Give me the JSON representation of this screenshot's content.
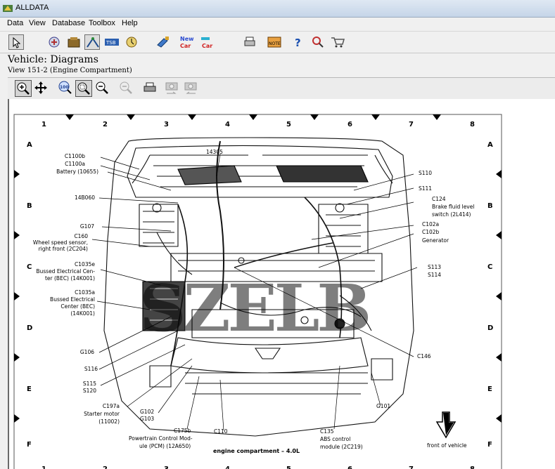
{
  "app": {
    "title": "ALLDATA"
  },
  "menu": [
    "Data",
    "View",
    "Database",
    "Toolbox",
    "Help"
  ],
  "toolbar_icons": [
    "back-icon",
    "repair-icon",
    "vehicle-box-icon",
    "diagram-icon",
    "tsb-icon",
    "labor-icon",
    "components-icon",
    "new-car-icon",
    "new-car-alt-icon",
    "print-icon",
    "note-icon",
    "help-icon",
    "search-icon",
    "cart-icon"
  ],
  "page": {
    "heading": "Vehicle:  Diagrams",
    "subheading": "View 151-2 (Engine Compartment)"
  },
  "diagram_tools": [
    "zoom-in-icon",
    "pan-icon",
    "fit-100-icon",
    "zoom-window-icon",
    "zoom-out-icon",
    "zoom-out-disabled-icon",
    "print-icon",
    "camera-prev-icon",
    "camera-next-icon"
  ],
  "diagram": {
    "columns": [
      "1",
      "2",
      "3",
      "4",
      "5",
      "6",
      "7",
      "8"
    ],
    "rows": [
      "A",
      "B",
      "C",
      "D",
      "E",
      "F"
    ],
    "labels": {
      "c1100b": "C1100b",
      "c1100a": "C1100a",
      "battery": "Battery (10655)",
      "n14305": "14305",
      "n14b060": "14B060",
      "g107": "G107",
      "c160": "C160",
      "wheel_speed": "Wheel speed sensor,",
      "wheel_speed2": "right front (2C204)",
      "c1035e": "C1035e",
      "bec1": "Bussed Electrical Cen-",
      "bec1b": "ter (BEC) (14K001)",
      "c1035a": "C1035a",
      "bec2": "Bussed Electrical",
      "bec2b": "Center (BEC)",
      "bec2c": "(14K001)",
      "g106": "G106",
      "s116": "S116",
      "s115": "S115",
      "s120": "S120",
      "c197a": "C197a",
      "starter": "Starter motor",
      "starter2": "(11002)",
      "g102": "G102",
      "g103": "G103",
      "c175b": "C175b",
      "pcm": "Powertrain Control Mod-",
      "pcm2": "ule (PCM) (12A650)",
      "c110": "C110",
      "c135": "C135",
      "abs": "ABS control",
      "abs2": "module (2C219)",
      "g101": "G101",
      "c146": "C146",
      "s110": "S110",
      "s111": "S111",
      "c124": "C124",
      "brake": "Brake fluid level",
      "brake2": "switch (2L414)",
      "c102a": "C102a",
      "c102b": "C102b",
      "generator": "Generator",
      "s113": "S113",
      "s114": "S114",
      "caption": "engine compartment – 4.0L",
      "front": "front of vehicle"
    },
    "watermark": "SZELB"
  }
}
